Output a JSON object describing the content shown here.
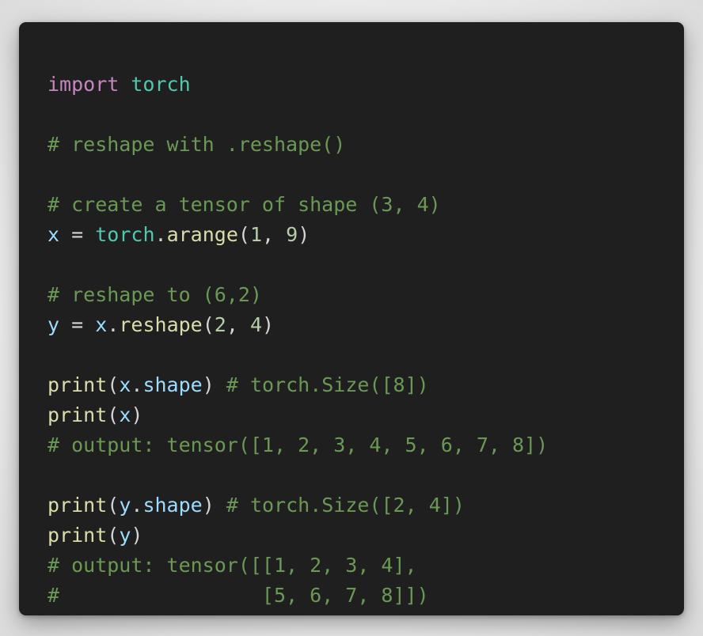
{
  "code": {
    "line_1": {
      "keyword": "import",
      "module": "torch"
    },
    "line_3": {
      "comment": "# reshape with .reshape()"
    },
    "line_5": {
      "comment": "# create a tensor of shape (3, 4)"
    },
    "line_6": {
      "var": "x",
      "op": "=",
      "module": "torch",
      "dot": ".",
      "func": "arange",
      "open": "(",
      "arg1": "1",
      "sep": ", ",
      "arg2": "9",
      "close": ")"
    },
    "line_8": {
      "comment": "# reshape to (6,2)"
    },
    "line_9": {
      "var": "y",
      "op": "=",
      "obj": "x",
      "dot": ".",
      "func": "reshape",
      "open": "(",
      "arg1": "2",
      "sep": ", ",
      "arg2": "4",
      "close": ")"
    },
    "line_11": {
      "func": "print",
      "open": "(",
      "obj": "x",
      "dot": ".",
      "attr": "shape",
      "close": ")",
      "comment": "# torch.Size([8])"
    },
    "line_12": {
      "func": "print",
      "open": "(",
      "obj": "x",
      "close": ")"
    },
    "line_13": {
      "comment": "# output: tensor([1, 2, 3, 4, 5, 6, 7, 8])"
    },
    "line_15": {
      "func": "print",
      "open": "(",
      "obj": "y",
      "dot": ".",
      "attr": "shape",
      "close": ")",
      "comment": "# torch.Size([2, 4])"
    },
    "line_16": {
      "func": "print",
      "open": "(",
      "obj": "y",
      "close": ")"
    },
    "line_17": {
      "comment": "# output: tensor([[1, 2, 3, 4],"
    },
    "line_18": {
      "comment": "#                 [5, 6, 7, 8]])"
    }
  },
  "colors": {
    "background": "#1f1f1f",
    "keyword": "#c586c0",
    "module": "#4ec9b0",
    "variable": "#9cdcfe",
    "function": "#dcdcaa",
    "comment": "#6a9955",
    "number": "#b5cea8",
    "text": "#d4d4d4"
  }
}
